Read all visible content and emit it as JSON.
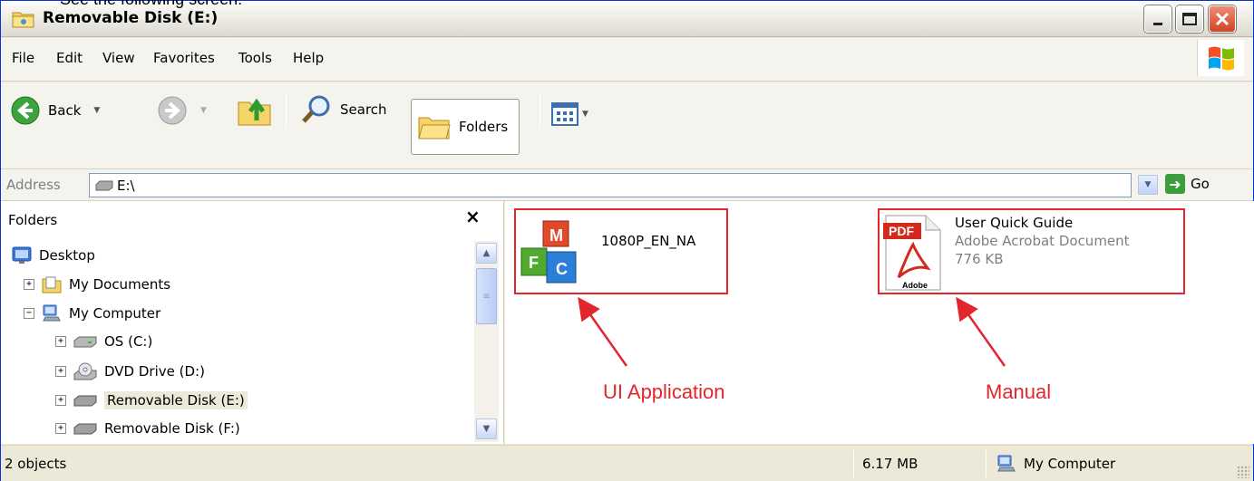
{
  "caption": "See the following screen:",
  "window": {
    "title": "Removable Disk (E:)"
  },
  "menu": {
    "items": [
      "File",
      "Edit",
      "View",
      "Favorites",
      "Tools",
      "Help"
    ]
  },
  "toolbar": {
    "back_label": "Back",
    "search_label": "Search",
    "folders_label": "Folders"
  },
  "address": {
    "label": "Address",
    "value": "E:\\",
    "go_label": "Go"
  },
  "folders_pane": {
    "title": "Folders",
    "close_glyph": "×",
    "tree": [
      {
        "label": "Desktop",
        "icon": "desktop-icon"
      },
      {
        "label": "My Documents",
        "icon": "documents-icon"
      },
      {
        "label": "My Computer",
        "icon": "computer-icon"
      },
      {
        "label": "OS (C:)",
        "icon": "drive-icon"
      },
      {
        "label": "DVD Drive (D:)",
        "icon": "dvd-icon"
      },
      {
        "label": "Removable Disk (E:)",
        "icon": "removable-disk-icon",
        "selected": true
      },
      {
        "label": "Removable Disk (F:)",
        "icon": "removable-disk-icon"
      }
    ]
  },
  "files": [
    {
      "name": "1080P_EN_NA",
      "icon": "mfc-app-icon"
    },
    {
      "name": "User Quick Guide",
      "type": "Adobe Acrobat Document",
      "size": "776 KB",
      "icon": "pdf-icon",
      "icon_text": "PDF",
      "icon_brand": "Adobe"
    }
  ],
  "annotations": {
    "app_label": "UI Application",
    "manual_label": "Manual",
    "color": "#e3262d"
  },
  "status": {
    "count": "2 objects",
    "size": "6.17 MB",
    "location": "My Computer"
  },
  "colors": {
    "accent": "#0831d9",
    "close": "#d04524"
  }
}
